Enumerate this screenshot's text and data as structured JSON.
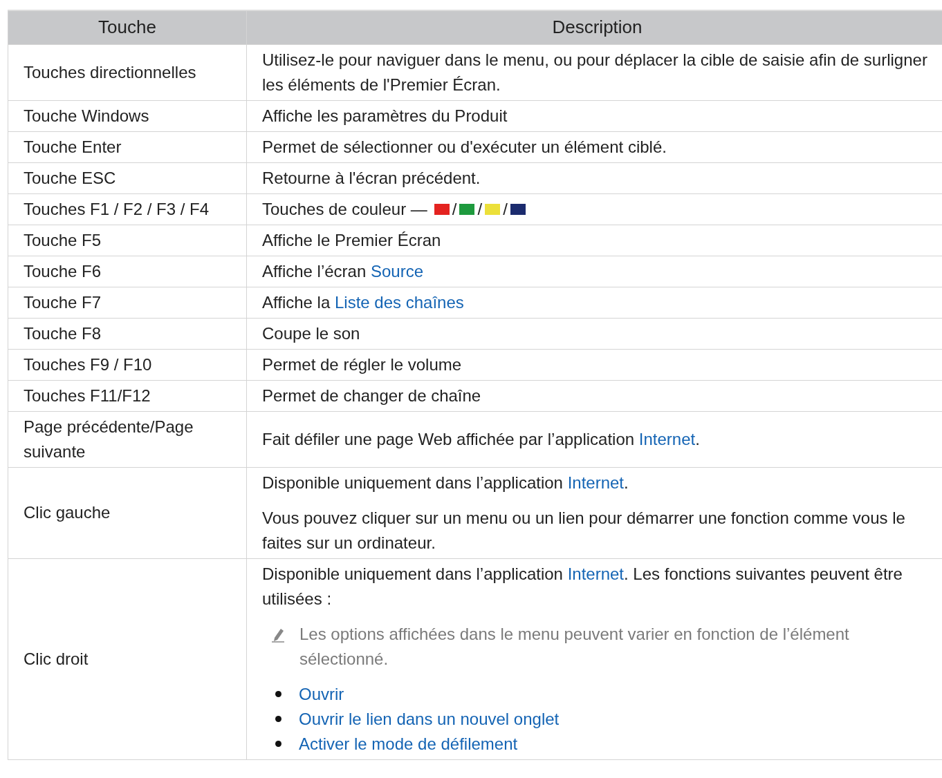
{
  "table": {
    "columns": [
      "Touche",
      "Description"
    ],
    "rows": [
      {
        "key": "Touches directionnelles",
        "description": [
          {
            "kind": "text",
            "segments": [
              {
                "text": "Utilisez-le pour naviguer dans le menu, ou pour déplacer la cible de saisie afin de surligner les éléments de l'Premier Écran."
              }
            ]
          }
        ]
      },
      {
        "key": "Touche Windows",
        "description": [
          {
            "kind": "text",
            "segments": [
              {
                "text": "Affiche les paramètres du Produit"
              }
            ]
          }
        ]
      },
      {
        "key": "Touche Enter",
        "description": [
          {
            "kind": "text",
            "segments": [
              {
                "text": "Permet de sélectionner ou d'exécuter un élément ciblé."
              }
            ]
          }
        ]
      },
      {
        "key": "Touche ESC",
        "description": [
          {
            "kind": "text",
            "segments": [
              {
                "text": "Retourne à l'écran précédent."
              }
            ]
          }
        ]
      },
      {
        "key": "Touches F1 / F2 / F3 / F4",
        "description": [
          {
            "kind": "color-keys",
            "label": "Touches de couleur —",
            "items": [
              {
                "kind": "swatch",
                "color": "#e42320"
              },
              {
                "kind": "separator",
                "text": "/"
              },
              {
                "kind": "swatch",
                "color": "#1e9a3e"
              },
              {
                "kind": "separator",
                "text": "/"
              },
              {
                "kind": "swatch",
                "color": "#ece03a"
              },
              {
                "kind": "separator",
                "text": "/"
              },
              {
                "kind": "swatch",
                "color": "#1b2b6e"
              }
            ]
          }
        ]
      },
      {
        "key": "Touche F5",
        "description": [
          {
            "kind": "text",
            "segments": [
              {
                "text": "Affiche le Premier Écran"
              }
            ]
          }
        ]
      },
      {
        "key": "Touche F6",
        "description": [
          {
            "kind": "text",
            "segments": [
              {
                "text": "Affiche l’écran "
              },
              {
                "text": "Source",
                "link": true
              }
            ]
          }
        ]
      },
      {
        "key": "Touche F7",
        "description": [
          {
            "kind": "text",
            "segments": [
              {
                "text": "Affiche la "
              },
              {
                "text": "Liste des chaînes",
                "link": true
              }
            ]
          }
        ]
      },
      {
        "key": "Touche F8",
        "description": [
          {
            "kind": "text",
            "segments": [
              {
                "text": "Coupe le son"
              }
            ]
          }
        ]
      },
      {
        "key": "Touches F9 / F10",
        "description": [
          {
            "kind": "text",
            "segments": [
              {
                "text": "Permet de régler le volume"
              }
            ]
          }
        ]
      },
      {
        "key": "Touches F11/F12",
        "description": [
          {
            "kind": "text",
            "segments": [
              {
                "text": "Permet de changer de chaîne"
              }
            ]
          }
        ]
      },
      {
        "key": "Page précédente/Page suivante",
        "description": [
          {
            "kind": "text",
            "segments": [
              {
                "text": "Fait défiler une page Web affichée par l’application "
              },
              {
                "text": "Internet",
                "link": true
              },
              {
                "text": "."
              }
            ]
          }
        ]
      },
      {
        "key": "Clic gauche",
        "description": [
          {
            "kind": "text",
            "segments": [
              {
                "text": "Disponible uniquement dans l’application "
              },
              {
                "text": "Internet",
                "link": true
              },
              {
                "text": "."
              }
            ]
          },
          {
            "kind": "text",
            "segments": [
              {
                "text": "Vous pouvez cliquer sur un menu ou un lien pour démarrer une fonction comme vous le faites sur un ordinateur."
              }
            ]
          }
        ]
      },
      {
        "key": "Clic droit",
        "description": [
          {
            "kind": "text",
            "segments": [
              {
                "text": "Disponible uniquement dans l’application "
              },
              {
                "text": "Internet",
                "link": true
              },
              {
                "text": ". Les fonctions suivantes peuvent être utilisées :"
              }
            ]
          },
          {
            "kind": "note",
            "text": "Les options affichées dans le menu peuvent varier en fonction de l’élément sélectionné."
          },
          {
            "kind": "list",
            "items": [
              {
                "text": "Ouvrir"
              },
              {
                "text": "Ouvrir le lien dans un nouvel onglet"
              },
              {
                "text": "Activer le mode de défilement"
              }
            ]
          }
        ]
      }
    ]
  }
}
